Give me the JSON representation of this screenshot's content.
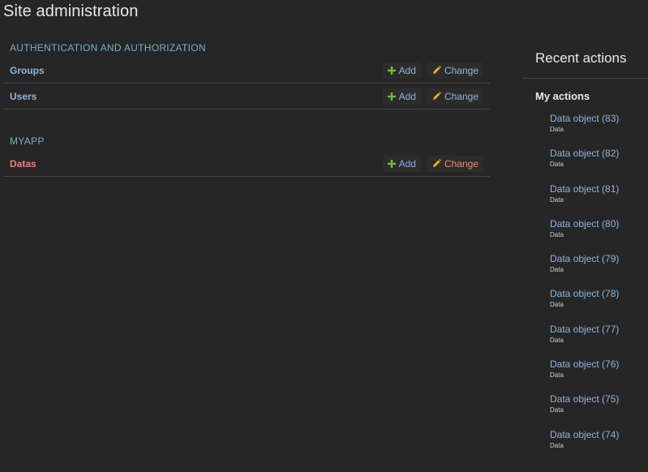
{
  "page": {
    "title": "Site administration"
  },
  "apps": [
    {
      "caption": "AUTHENTICATION AND AUTHORIZATION",
      "models": [
        {
          "name": "Groups",
          "add_label": "Add",
          "change_label": "Change"
        },
        {
          "name": "Users",
          "add_label": "Add",
          "change_label": "Change"
        }
      ]
    },
    {
      "caption": "MYAPP",
      "models": [
        {
          "name": "Datas",
          "add_label": "Add",
          "change_label": "Change"
        }
      ]
    }
  ],
  "sidebar": {
    "title": "Recent actions",
    "subtitle": "My actions",
    "actions": [
      {
        "object": "Data object (83)",
        "type": "Data"
      },
      {
        "object": "Data object (82)",
        "type": "Data"
      },
      {
        "object": "Data object (81)",
        "type": "Data"
      },
      {
        "object": "Data object (80)",
        "type": "Data"
      },
      {
        "object": "Data object (79)",
        "type": "Data"
      },
      {
        "object": "Data object (78)",
        "type": "Data"
      },
      {
        "object": "Data object (77)",
        "type": "Data"
      },
      {
        "object": "Data object (76)",
        "type": "Data"
      },
      {
        "object": "Data object (75)",
        "type": "Data"
      },
      {
        "object": "Data object (74)",
        "type": "Data"
      }
    ]
  },
  "colors": {
    "background": "#262626",
    "link": "#8ab4e0",
    "caption": "#79aec8",
    "add_icon": "#6cbf3a",
    "change_icon": "#f0b400",
    "highlight_row": "#e87e7e"
  },
  "icons": {
    "add": "plus-icon",
    "change": "pencil-icon"
  }
}
